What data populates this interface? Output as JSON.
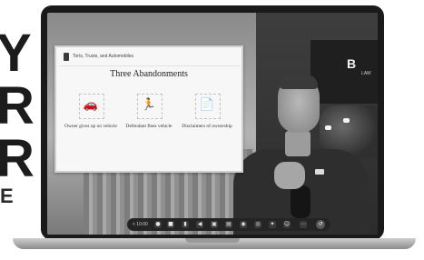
{
  "slide": {
    "header_text": "Torts, Trusts, and Automobiles",
    "title": "Three Abandonments",
    "items": [
      {
        "caption": "Owner gives up on vehicle",
        "icon": "car-icon"
      },
      {
        "caption": "Defendant flees vehicle",
        "icon": "person-running-icon"
      },
      {
        "caption": "Disclaimers of ownership",
        "icon": "document-sign-icon"
      }
    ]
  },
  "video_background": {
    "firm_logo": "B",
    "firm_sub": "LAW"
  },
  "control_bar": {
    "time": "< 10:00",
    "buttons": [
      {
        "icon": "record-icon",
        "glyph": "●"
      },
      {
        "icon": "camera-icon",
        "glyph": "■"
      },
      {
        "icon": "mic-icon",
        "glyph": "▮"
      },
      {
        "icon": "speaker-icon",
        "glyph": "◀"
      },
      {
        "icon": "screen-share-icon",
        "glyph": "▣"
      },
      {
        "icon": "chat-icon",
        "glyph": "▤"
      },
      {
        "icon": "participants-icon",
        "glyph": "◉"
      },
      {
        "icon": "reactions-icon",
        "glyph": "◎"
      },
      {
        "icon": "settings-icon",
        "glyph": "✦"
      },
      {
        "icon": "emoji-icon",
        "glyph": "☺"
      },
      {
        "icon": "more-icon",
        "glyph": "⋯"
      }
    ],
    "end_glyph": "↺"
  },
  "decor": {
    "big_letters": [
      "Y",
      "R",
      "R"
    ],
    "small_letters": "E"
  },
  "colors": {
    "bezel": "#1a1a1a",
    "slide_bg": "#f7f7f7",
    "control_bar": "#242424"
  }
}
